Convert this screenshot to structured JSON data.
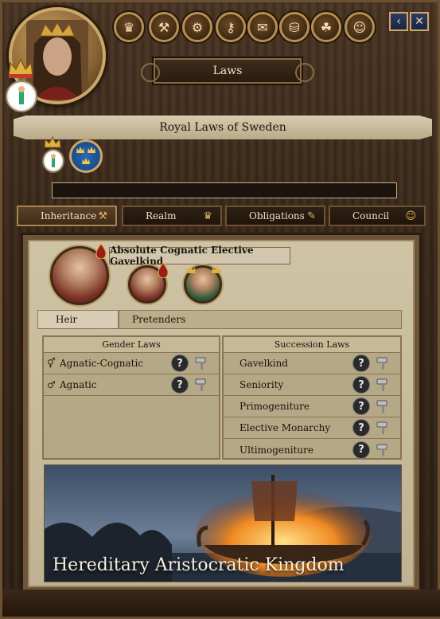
{
  "header": {
    "title": "Laws",
    "toolbar_icons": [
      "crown-icon",
      "hammer-icon",
      "gears-icon",
      "key-icon",
      "scroll-icon",
      "coins-icon",
      "triquetra-icon",
      "people-icon"
    ]
  },
  "realm": {
    "banner": "Royal Laws of Sweden",
    "search_value": ""
  },
  "tabs": [
    {
      "label": "Inheritance",
      "icon": "gavel-icon"
    },
    {
      "label": "Realm",
      "icon": "crown-icon"
    },
    {
      "label": "Obligations",
      "icon": "quill-icon"
    },
    {
      "label": "Council",
      "icon": "people-icon"
    }
  ],
  "succession": {
    "current_law": "Absolute Cognatic Elective Gavelkind",
    "heir_tab": "Heir",
    "pretenders_tab": "Pretenders"
  },
  "gender_laws": {
    "heading": "Gender Laws",
    "items": [
      {
        "label": "Agnatic-Cognatic",
        "icon": "gender-mixed-icon"
      },
      {
        "label": "Agnatic",
        "icon": "male-icon"
      }
    ]
  },
  "succession_laws": {
    "heading": "Succession Laws",
    "items": [
      {
        "label": "Gavelkind"
      },
      {
        "label": "Seniority"
      },
      {
        "label": "Primogeniture"
      },
      {
        "label": "Elective Monarchy"
      },
      {
        "label": "Ultimogeniture"
      }
    ]
  },
  "illustration": {
    "caption": "Hereditary Aristocratic Kingdom"
  },
  "colors": {
    "wood": "#3a2819",
    "parchment": "#cfc3a6",
    "gold": "#c9a96b",
    "sweden_blue": "#1b4c8b"
  }
}
